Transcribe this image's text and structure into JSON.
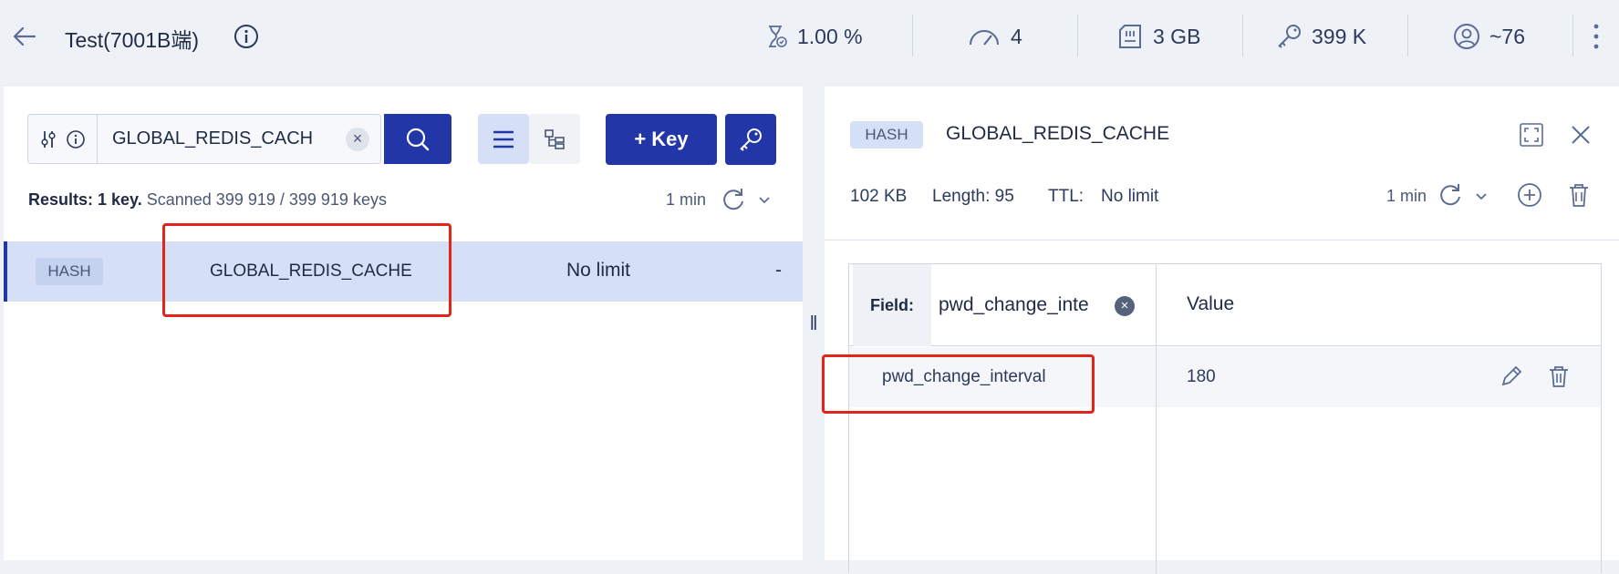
{
  "header": {
    "db_name": "Test(7001B端)",
    "stats": {
      "cpu": "1.00 %",
      "commands": "4",
      "memory": "3 GB",
      "keys": "399 K",
      "clients": "~76"
    }
  },
  "browser": {
    "search_value": "GLOBAL_REDIS_CACH",
    "add_key_label": "+ Key",
    "results_bold": "Results: 1 key.",
    "results_rest": "Scanned 399 919 / 399 919 keys",
    "refresh_time": "1 min",
    "rows": [
      {
        "type": "HASH",
        "name": "GLOBAL_REDIS_CACHE",
        "ttl": "No limit",
        "size": "-"
      }
    ]
  },
  "details": {
    "type": "HASH",
    "key_name": "GLOBAL_REDIS_CACHE",
    "size": "102 KB",
    "length_label": "Length: 95",
    "ttl_label": "TTL:",
    "ttl_value": "No limit",
    "refresh_time": "1 min",
    "table": {
      "field_label": "Field:",
      "field_filter": "pwd_change_inte",
      "value_header": "Value",
      "rows": [
        {
          "field": "pwd_change_interval",
          "value": "180"
        }
      ]
    }
  },
  "colors": {
    "primary": "#2236a8",
    "selected_row": "#d5e0f7",
    "highlight_box": "#e1251b"
  }
}
